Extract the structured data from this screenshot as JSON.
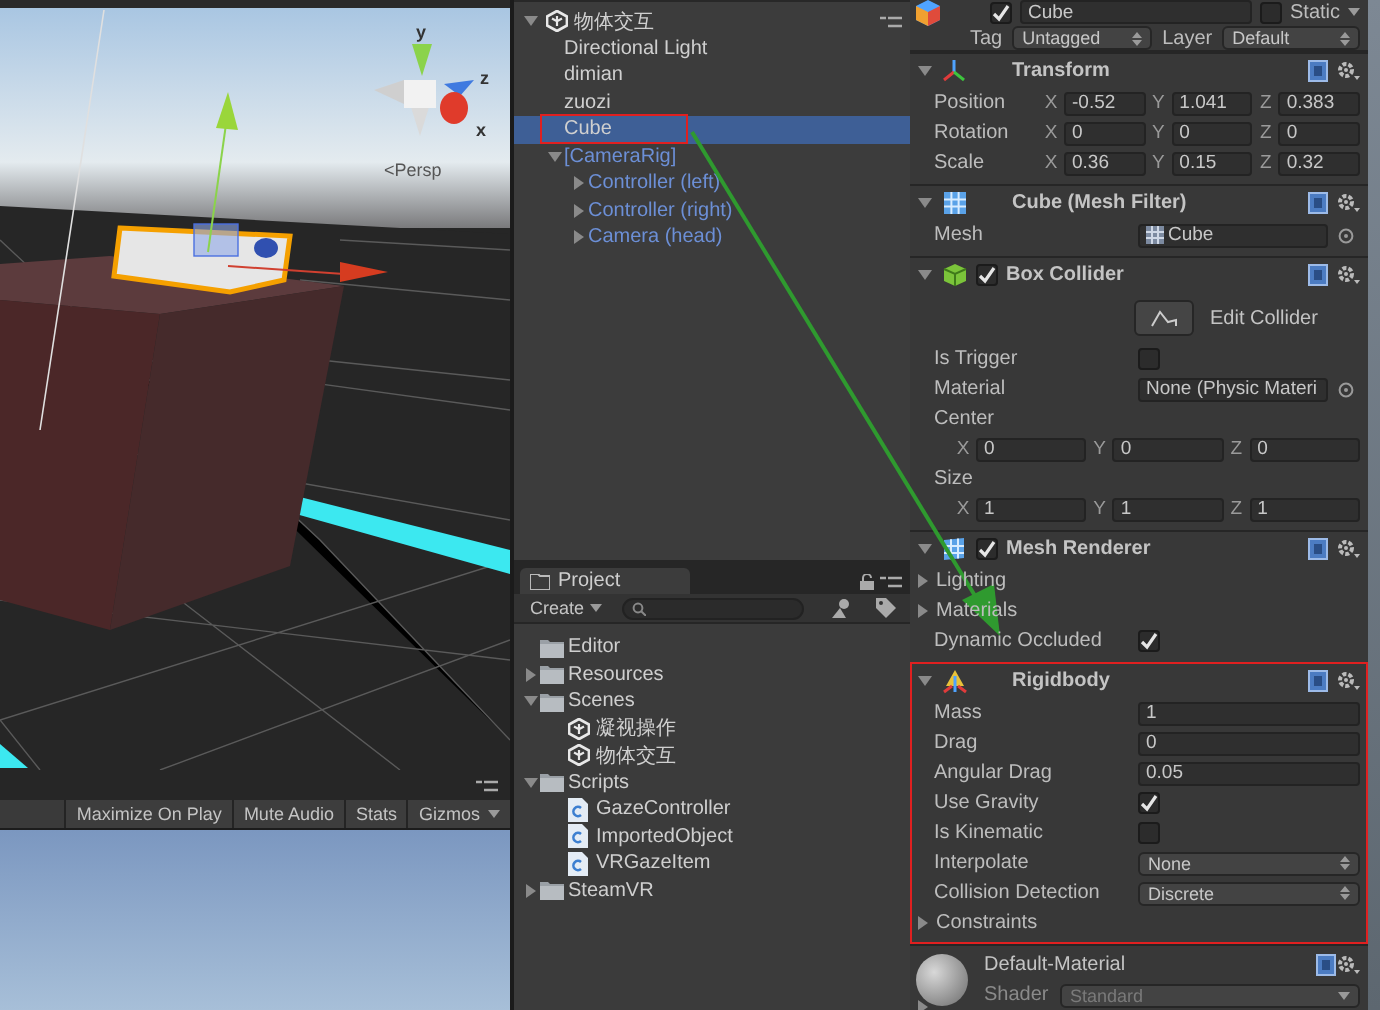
{
  "scene_view": {
    "persp_label": "<Persp",
    "gizmo_axes": [
      "y",
      "z",
      "x"
    ]
  },
  "game_view": {
    "toolbar": [
      {
        "label": "Maximize On Play",
        "kind": "toggle"
      },
      {
        "label": "Mute Audio",
        "kind": "toggle"
      },
      {
        "label": "Stats",
        "kind": "toggle"
      },
      {
        "label": "Gizmos",
        "kind": "dropdown"
      }
    ]
  },
  "hierarchy": {
    "scene": "物体交互",
    "expanded": true,
    "items": [
      {
        "label": "Directional Light",
        "kind": "object",
        "selected": false,
        "highlighted": false
      },
      {
        "label": "dimian",
        "kind": "object",
        "selected": false,
        "highlighted": false
      },
      {
        "label": "zuozi",
        "kind": "object",
        "selected": false,
        "highlighted": false
      },
      {
        "label": "Cube",
        "kind": "object",
        "selected": true,
        "highlighted": true
      },
      {
        "label": "[CameraRig]",
        "kind": "prefab",
        "selected": false,
        "highlighted": false,
        "expanded": true,
        "children": [
          {
            "label": "Controller (left)",
            "kind": "prefab",
            "selected": false,
            "highlighted": false,
            "expanded": false
          },
          {
            "label": "Controller (right)",
            "kind": "prefab",
            "selected": false,
            "highlighted": false,
            "expanded": false
          },
          {
            "label": "Camera (head)",
            "kind": "prefab",
            "selected": false,
            "highlighted": false,
            "expanded": false
          }
        ]
      }
    ]
  },
  "project": {
    "tab": "Project",
    "create": "Create",
    "tree": [
      {
        "label": "Editor",
        "kind": "folder"
      },
      {
        "label": "Resources",
        "kind": "folder",
        "expanded": false
      },
      {
        "label": "Scenes",
        "kind": "folder",
        "expanded": true,
        "children": [
          {
            "label": "凝视操作",
            "kind": "scene"
          },
          {
            "label": "物体交互",
            "kind": "scene"
          }
        ]
      },
      {
        "label": "Scripts",
        "kind": "folder",
        "expanded": true,
        "children": [
          {
            "label": "GazeController",
            "kind": "script"
          },
          {
            "label": "ImportedObject",
            "kind": "script"
          },
          {
            "label": "VRGazeItem",
            "kind": "script"
          }
        ]
      },
      {
        "label": "SteamVR",
        "kind": "folder",
        "expanded": false
      }
    ]
  },
  "inspector": {
    "name": "Cube",
    "active": true,
    "static_label": "Static",
    "static": false,
    "tag_label": "Tag",
    "tag": "Untagged",
    "layer_label": "Layer",
    "layer": "Default",
    "components": [
      {
        "kind": "transform",
        "title": "Transform",
        "expanded": true,
        "highlighted": false,
        "rows": [
          {
            "label": "Position",
            "values": [
              {
                "axis": "X",
                "value": "-0.52"
              },
              {
                "axis": "Y",
                "value": "1.041"
              },
              {
                "axis": "Z",
                "value": "0.383"
              }
            ]
          },
          {
            "label": "Rotation",
            "values": [
              {
                "axis": "X",
                "value": "0"
              },
              {
                "axis": "Y",
                "value": "0"
              },
              {
                "axis": "Z",
                "value": "0"
              }
            ]
          },
          {
            "label": "Scale",
            "values": [
              {
                "axis": "X",
                "value": "0.36"
              },
              {
                "axis": "Y",
                "value": "0.15"
              },
              {
                "axis": "Z",
                "value": "0.32"
              }
            ]
          }
        ]
      },
      {
        "kind": "mesh_filter",
        "title": "Cube (Mesh Filter)",
        "expanded": true,
        "highlighted": false,
        "props": [
          {
            "kind": "asset",
            "label": "Mesh",
            "value": "Cube"
          }
        ]
      },
      {
        "kind": "box_collider",
        "title": "Box Collider",
        "enabled": true,
        "expanded": true,
        "highlighted": false,
        "props": [
          {
            "kind": "button",
            "label": "Edit Collider"
          },
          {
            "kind": "checkbox",
            "label": "Is Trigger",
            "checked": false
          },
          {
            "kind": "object",
            "label": "Material",
            "value": "None (Physic Materi"
          },
          {
            "kind": "vector",
            "label": "Center",
            "values": [
              {
                "axis": "X",
                "value": "0"
              },
              {
                "axis": "Y",
                "value": "0"
              },
              {
                "axis": "Z",
                "value": "0"
              }
            ]
          },
          {
            "kind": "vector",
            "label": "Size",
            "values": [
              {
                "axis": "X",
                "value": "1"
              },
              {
                "axis": "Y",
                "value": "1"
              },
              {
                "axis": "Z",
                "value": "1"
              }
            ]
          }
        ]
      },
      {
        "kind": "mesh_renderer",
        "title": "Mesh Renderer",
        "enabled": true,
        "expanded": true,
        "highlighted": false,
        "props": [
          {
            "kind": "foldout",
            "label": "Lighting",
            "expanded": false
          },
          {
            "kind": "foldout",
            "label": "Materials",
            "expanded": false
          },
          {
            "kind": "checkbox",
            "label": "Dynamic Occluded",
            "checked": true
          }
        ]
      },
      {
        "kind": "rigidbody",
        "title": "Rigidbody",
        "expanded": true,
        "highlighted": true,
        "props": [
          {
            "kind": "number",
            "label": "Mass",
            "value": "1"
          },
          {
            "kind": "number",
            "label": "Drag",
            "value": "0"
          },
          {
            "kind": "number",
            "label": "Angular Drag",
            "value": "0.05"
          },
          {
            "kind": "checkbox",
            "label": "Use Gravity",
            "checked": true
          },
          {
            "kind": "checkbox",
            "label": "Is Kinematic",
            "checked": false
          },
          {
            "kind": "dropdown",
            "label": "Interpolate",
            "value": "None"
          },
          {
            "kind": "dropdown",
            "label": "Collision Detection",
            "value": "Discrete"
          },
          {
            "kind": "foldout",
            "label": "Constraints",
            "expanded": false
          }
        ]
      },
      {
        "kind": "material",
        "title": "Default-Material",
        "expanded": false,
        "highlighted": false,
        "shader_label": "Shader",
        "shader": "Standard"
      }
    ]
  }
}
